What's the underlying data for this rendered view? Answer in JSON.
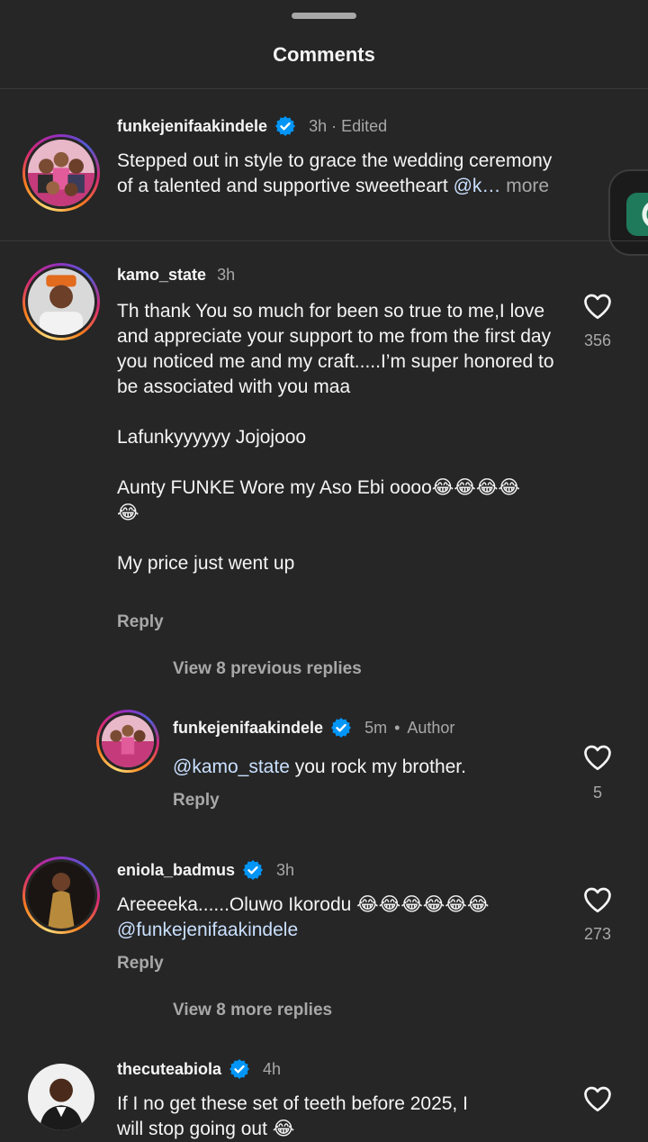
{
  "header": {
    "title": "Comments"
  },
  "caption": {
    "username": "funkejenifaakindele",
    "meta": "3h · Edited",
    "text_line1": "Stepped out in style to grace the wedding ceremony",
    "text_line2_prefix": "of a talented and supportive sweetheart ",
    "text_line2_mention": "@k…",
    "text_line2_more": " more"
  },
  "comments": [
    {
      "username": "kamo_state",
      "time": "3h",
      "paragraphs": [
        "Th thank You so much for been so true to me,I love and appreciate your support to me from the first day you noticed me and my craft.....I’m super honored to be associated with you maa",
        "Lafunkyyyyyy Jojojooo",
        "Aunty FUNKE Wore my Aso Ebi oooo😂😂😂😂😂",
        "My price just went up"
      ],
      "likes": "356",
      "reply_label": "Reply",
      "view_replies": "View 8 previous replies"
    },
    {
      "username": "funkejenifaakindele",
      "time": "5m",
      "author_label": "Author",
      "mention": "@kamo_state",
      "text": " you rock my brother.",
      "likes": "5",
      "reply_label": "Reply"
    },
    {
      "username": "eniola_badmus",
      "time": "3h",
      "text_line1": "Areeeeka......Oluwo Ikorodu 😂😂😂😂😂😂",
      "mention": "@funkejenifaakindele",
      "likes": "273",
      "reply_label": "Reply",
      "view_replies": "View 8 more replies"
    },
    {
      "username": "thecuteabiola",
      "time": "4h",
      "text_line1": "If I no get these set of teeth before 2025, I",
      "text_line2": "will stop going out 😂"
    }
  ],
  "icons": [
    "verified-badge-icon",
    "heart-icon"
  ],
  "colors": {
    "background": "#262626",
    "verified": "#0095f6",
    "muted": "#a8a8a8"
  }
}
